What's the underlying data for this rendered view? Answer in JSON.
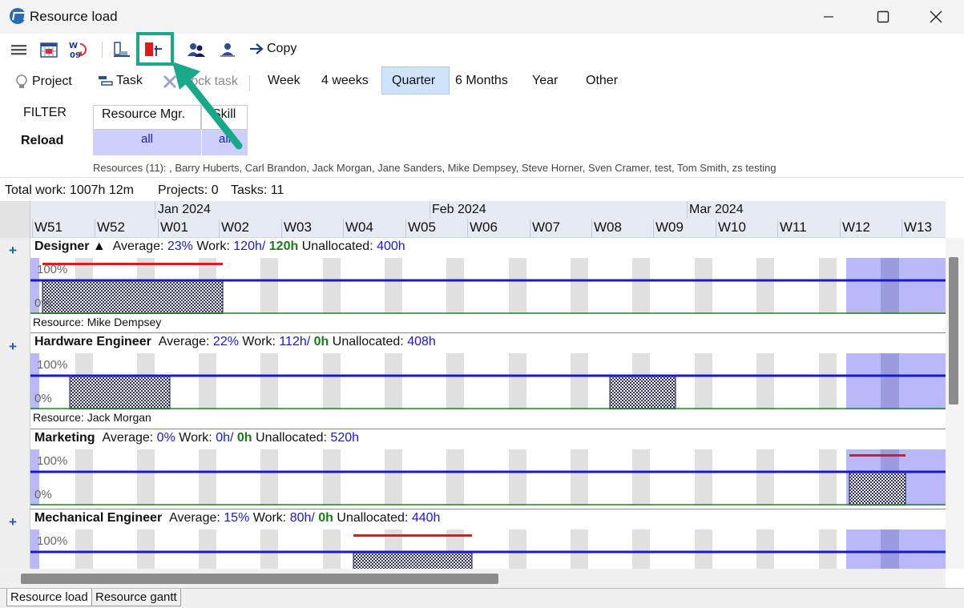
{
  "window": {
    "title": "Resource load"
  },
  "toolbar": {
    "copy_label": "Copy"
  },
  "timescale": {
    "project_label": "Project",
    "task_label": "Task",
    "block_task_label": "Block task",
    "options": [
      "Week",
      "4 weeks",
      "Quarter",
      "6 Months",
      "Year",
      "Other"
    ],
    "selected": "Quarter"
  },
  "filter": {
    "filter_label": "FILTER",
    "reload_label": "Reload",
    "columns": [
      {
        "header": "Resource Mgr.",
        "value": "all"
      },
      {
        "header": "Skill",
        "value": "all"
      }
    ],
    "resources_text": "Resources (11): , Barry Huberts, Carl Brandon, Jack Morgan, Jane Sanders, Mike Dempsey, Steve Horner, Sven Cramer, test, Tom Smith, zs testing"
  },
  "totals": {
    "total_work": "Total work: 1007h 12m",
    "projects": "Projects: 0",
    "tasks": "Tasks: 11"
  },
  "timeline": {
    "months": [
      "Jan 2024",
      "Feb 2024",
      "Mar 2024"
    ],
    "weeks": [
      "W51",
      "W52",
      "W01",
      "W02",
      "W03",
      "W04",
      "W05",
      "W06",
      "W07",
      "W08",
      "W09",
      "W10",
      "W11",
      "W12",
      "W13"
    ]
  },
  "sections": [
    {
      "name": "Designer",
      "sort_mark": "▲",
      "average_label": "Average:",
      "average": "23%",
      "work_label": "Work:",
      "work": "120h/",
      "work_alloc": "120h",
      "unalloc_label": "Unallocated:",
      "unallocated": "400h",
      "pct100": "100%",
      "pct0": "0%",
      "resource": "Resource: Mike Dempsey"
    },
    {
      "name": "Hardware Engineer",
      "average_label": "Average:",
      "average": "22%",
      "work_label": "Work:",
      "work": "112h/",
      "work_alloc": "0h",
      "unalloc_label": "Unallocated:",
      "unallocated": "408h",
      "pct100": "100%",
      "pct0": "0%",
      "resource": "Resource: Jack Morgan"
    },
    {
      "name": "Marketing",
      "average_label": "Average:",
      "average": "0%",
      "work_label": "Work:",
      "work": "0h/",
      "work_alloc": "0h",
      "unalloc_label": "Unallocated:",
      "unallocated": "520h",
      "pct100": "100%",
      "pct0": "0%"
    },
    {
      "name": "Mechanical Engineer",
      "average_label": "Average:",
      "average": "15%",
      "work_label": "Work:",
      "work": "80h/",
      "work_alloc": "0h",
      "unalloc_label": "Unallocated:",
      "unallocated": "440h",
      "pct100": "100%"
    }
  ],
  "bottom_tabs": [
    "Resource load",
    "Resource gantt"
  ],
  "colors": {
    "accent": "#1a1acb",
    "highlight": "#17a98a",
    "overload": "#e01a1a",
    "weekend": "#e0e0e0",
    "selected_range": "#b9b9f7"
  }
}
